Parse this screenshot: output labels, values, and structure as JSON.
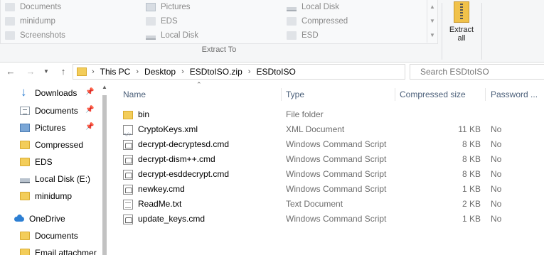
{
  "ribbon": {
    "destinations": [
      [
        {
          "label": "Documents",
          "icon": "documents-icon"
        },
        {
          "label": "minidump",
          "icon": "folder-icon"
        },
        {
          "label": "Screenshots",
          "icon": "folder-icon"
        }
      ],
      [
        {
          "label": "Pictures",
          "icon": "pictures-icon"
        },
        {
          "label": "EDS",
          "icon": "folder-icon"
        },
        {
          "label": "Local Disk",
          "icon": "drive-icon"
        }
      ],
      [
        {
          "label": "Local Disk",
          "icon": "drive-icon"
        },
        {
          "label": "Compressed",
          "icon": "folder-icon"
        },
        {
          "label": "ESD",
          "icon": "folder-icon"
        }
      ]
    ],
    "group_label": "Extract To",
    "extract_all": {
      "line1": "Extract",
      "line2": "all"
    }
  },
  "address": {
    "crumbs": [
      "This PC",
      "Desktop",
      "ESDtoISO.zip",
      "ESDtoISO"
    ],
    "search_placeholder": "Search ESDtoISO"
  },
  "nav_pane": {
    "items": [
      {
        "label": "Downloads",
        "icon": "downloads-icon",
        "pinned": true
      },
      {
        "label": "Documents",
        "icon": "documents-icon",
        "pinned": true
      },
      {
        "label": "Pictures",
        "icon": "pictures-icon",
        "pinned": true
      },
      {
        "label": "Compressed",
        "icon": "folder-icon",
        "pinned": false
      },
      {
        "label": "EDS",
        "icon": "folder-icon",
        "pinned": false
      },
      {
        "label": "Local Disk (E:)",
        "icon": "drive-icon",
        "pinned": false
      },
      {
        "label": "minidump",
        "icon": "folder-icon",
        "pinned": false
      },
      {
        "label": "OneDrive",
        "icon": "onedrive-icon",
        "pinned": false
      },
      {
        "label": "Documents",
        "icon": "folder-icon",
        "pinned": false
      },
      {
        "label": "Email attachmer",
        "icon": "folder-icon",
        "pinned": false
      }
    ]
  },
  "file_list": {
    "columns": [
      "Name",
      "Type",
      "Compressed size",
      "Password ..."
    ],
    "rows": [
      {
        "name": "bin",
        "type": "File folder",
        "size": "",
        "password": "",
        "icon": "folder-icon"
      },
      {
        "name": "CryptoKeys.xml",
        "type": "XML Document",
        "size": "11 KB",
        "password": "No",
        "icon": "xml-file-icon"
      },
      {
        "name": "decrypt-decryptesd.cmd",
        "type": "Windows Command Script",
        "size": "8 KB",
        "password": "No",
        "icon": "cmd-file-icon"
      },
      {
        "name": "decrypt-dism++.cmd",
        "type": "Windows Command Script",
        "size": "8 KB",
        "password": "No",
        "icon": "cmd-file-icon"
      },
      {
        "name": "decrypt-esddecrypt.cmd",
        "type": "Windows Command Script",
        "size": "8 KB",
        "password": "No",
        "icon": "cmd-file-icon"
      },
      {
        "name": "newkey.cmd",
        "type": "Windows Command Script",
        "size": "1 KB",
        "password": "No",
        "icon": "cmd-file-icon"
      },
      {
        "name": "ReadMe.txt",
        "type": "Text Document",
        "size": "2 KB",
        "password": "No",
        "icon": "text-file-icon"
      },
      {
        "name": "update_keys.cmd",
        "type": "Windows Command Script",
        "size": "1 KB",
        "password": "No",
        "icon": "cmd-file-icon"
      }
    ]
  }
}
